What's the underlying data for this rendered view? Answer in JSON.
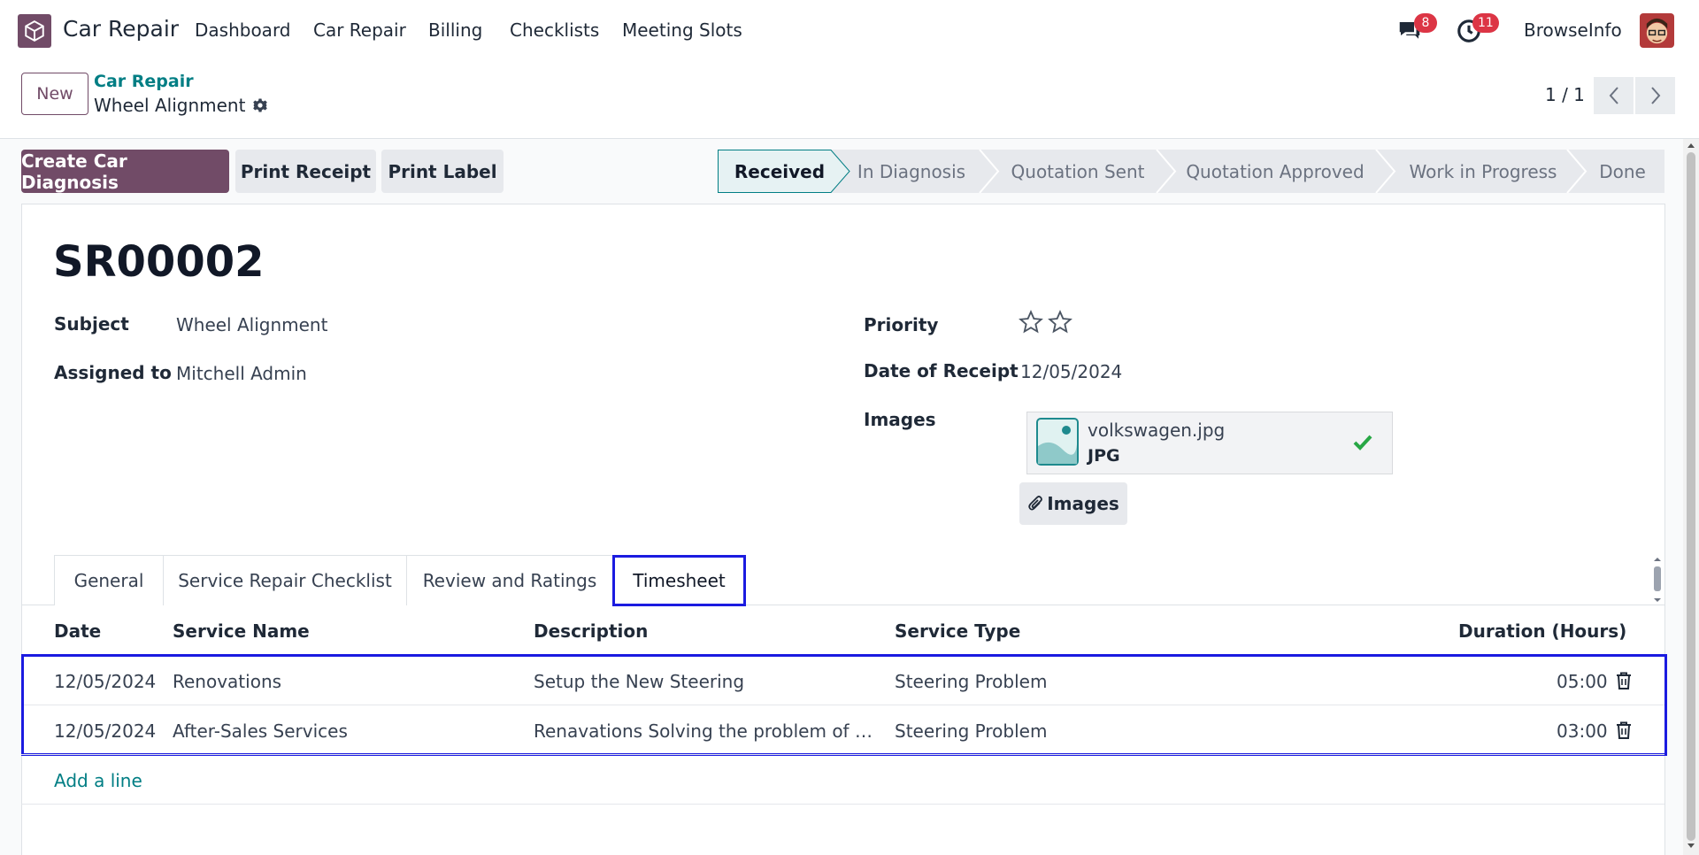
{
  "navbar": {
    "app_title": "Car Repair",
    "menus": [
      "Dashboard",
      "Car Repair",
      "Billing",
      "Checklists",
      "Meeting Slots"
    ],
    "messages_badge": "8",
    "activities_badge": "11",
    "company": "BrowseInfo"
  },
  "control_panel": {
    "new_label": "New",
    "breadcrumb_parent": "Car Repair",
    "breadcrumb_current": "Wheel Alignment",
    "pager": "1 / 1"
  },
  "actions": {
    "create_diagnosis": "Create Car Diagnosis",
    "print_receipt": "Print Receipt",
    "print_label": "Print Label"
  },
  "stages": {
    "active": "Received",
    "items": [
      "Received",
      "In Diagnosis",
      "Quotation Sent",
      "Quotation Approved",
      "Work in Progress",
      "Done"
    ]
  },
  "form": {
    "record_name": "SR00002",
    "subject_label": "Subject",
    "subject_value": "Wheel Alignment",
    "assigned_label": "Assigned to",
    "assigned_value": "Mitchell Admin",
    "priority_label": "Priority",
    "priority_stars": 0,
    "date_label": "Date of Receipt",
    "date_value": "12/05/2024",
    "images_label": "Images",
    "attachment_name": "volkswagen.jpg",
    "attachment_type": "JPG",
    "images_button": "Images"
  },
  "tabs": {
    "items": [
      "General",
      "Service Repair Checklist",
      "Review and Ratings",
      "Timesheet"
    ],
    "active": "Timesheet"
  },
  "timesheet": {
    "columns": [
      "Date",
      "Service Name",
      "Description",
      "Service Type",
      "Duration (Hours)"
    ],
    "rows": [
      {
        "date": "12/05/2024",
        "service": "Renovations",
        "description": "Setup the New Steering",
        "type": "Steering Problem",
        "duration": "05:00"
      },
      {
        "date": "12/05/2024",
        "service": "After-Sales Services",
        "description": "Renavations Solving the problem of su…",
        "type": "Steering Problem",
        "duration": "03:00"
      }
    ],
    "add_line": "Add a line"
  },
  "colors": {
    "brand": "#714b67",
    "link": "#017e84",
    "highlight": "#1b1be0",
    "badge": "#dc3545"
  }
}
